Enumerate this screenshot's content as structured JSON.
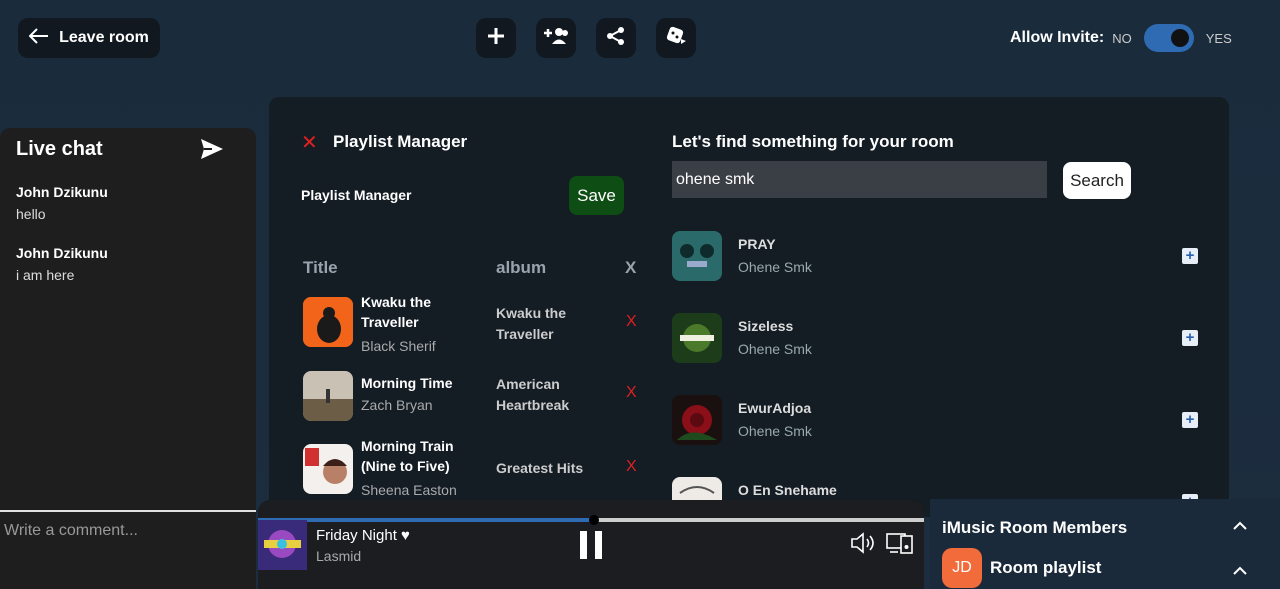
{
  "header": {
    "leave_label": "Leave room",
    "allow_invite_label": "Allow Invite:",
    "no_label": "NO",
    "yes_label": "YES",
    "toggle_on": true,
    "icons": [
      "add-icon",
      "add-user-icon",
      "share-icon",
      "shuffle-icon"
    ]
  },
  "chat": {
    "title": "Live chat",
    "messages": [
      {
        "author": "John Dzikunu",
        "text": "hello"
      },
      {
        "author": "John Dzikunu",
        "text": "i am here"
      }
    ],
    "placeholder": "Write a comment..."
  },
  "playlist_manager": {
    "title": "Playlist Manager",
    "subtitle": "Playlist Manager",
    "save_label": "Save",
    "columns": {
      "title": "Title",
      "album": "album",
      "remove": "X"
    },
    "rows": [
      {
        "title": "Kwaku the Traveller",
        "artist": "Black Sherif",
        "album": "Kwaku the Traveller",
        "remove": "X"
      },
      {
        "title": "Morning Time",
        "artist": "Zach Bryan",
        "album": "American Heartbreak",
        "remove": "X"
      },
      {
        "title": "Morning Train (Nine to Five)",
        "artist": "Sheena Easton",
        "album": "Greatest Hits",
        "remove": "X"
      }
    ]
  },
  "search": {
    "title": "Let's find something for your room",
    "value": "ohene smk",
    "button_label": "Search",
    "add_symbol": "+",
    "results": [
      {
        "title": "PRAY",
        "artist": "Ohene Smk"
      },
      {
        "title": "Sizeless",
        "artist": "Ohene Smk"
      },
      {
        "title": "EwurAdjoa",
        "artist": "Ohene Smk"
      },
      {
        "title": "O En Snehame",
        "artist": ""
      }
    ]
  },
  "player": {
    "title": "Friday Night ♥",
    "artist": "Lasmid",
    "progress": 0.505
  },
  "members": {
    "title": "iMusic Room Members",
    "avatar_initials": "JD",
    "room_playlist_label": "Room playlist"
  }
}
